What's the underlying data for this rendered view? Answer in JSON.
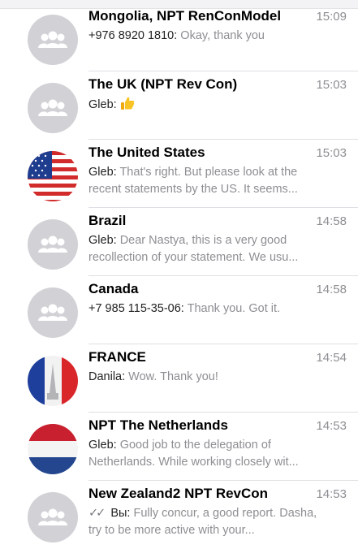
{
  "colors": {
    "name": "#000000",
    "preview": "#8e8e93",
    "avatar_group_bg": "#d1d1d6",
    "separator": "#e0e0e4"
  },
  "chats": [
    {
      "name": "Mongolia, NPT RenConModel",
      "time": "15:09",
      "sender": "+976 8920 1810:",
      "text": "Okay, thank you",
      "avatar": "group-icon"
    },
    {
      "name": "The UK (NPT Rev Con)",
      "time": "15:03",
      "sender": "Gleb:",
      "text": "",
      "emoji": "thumbs-up-icon",
      "avatar": "group-icon"
    },
    {
      "name": "The United States",
      "time": "15:03",
      "sender": "Gleb:",
      "text": "That's right. But please look at the recent statements by the US. It seems...",
      "avatar": "us-flag-icon"
    },
    {
      "name": "Brazil",
      "time": "14:58",
      "sender": "Gleb:",
      "text": "Dear Nastya, this is a very good recollection of your statement. We usu...",
      "avatar": "group-icon"
    },
    {
      "name": "Canada",
      "time": "14:58",
      "sender": "+7 985 115-35-06:",
      "text": "Thank you. Got it.",
      "avatar": "group-icon"
    },
    {
      "name": "FRANCE",
      "time": "14:54",
      "sender": "Danila:",
      "text": "Wow. Thank you!",
      "avatar": "france-flag-icon"
    },
    {
      "name": "NPT The Netherlands",
      "time": "14:53",
      "sender": "Gleb:",
      "text": "Good job to the delegation of Netherlands. While working closely wit...",
      "avatar": "netherlands-flag-icon"
    },
    {
      "name": "New Zealand2 NPT RevCon",
      "time": "14:53",
      "sender": "Вы:",
      "text": "Fully concur, a good report. Dasha, try to be more active with your...",
      "avatar": "group-icon",
      "read_ticks": "double-check-icon"
    }
  ]
}
